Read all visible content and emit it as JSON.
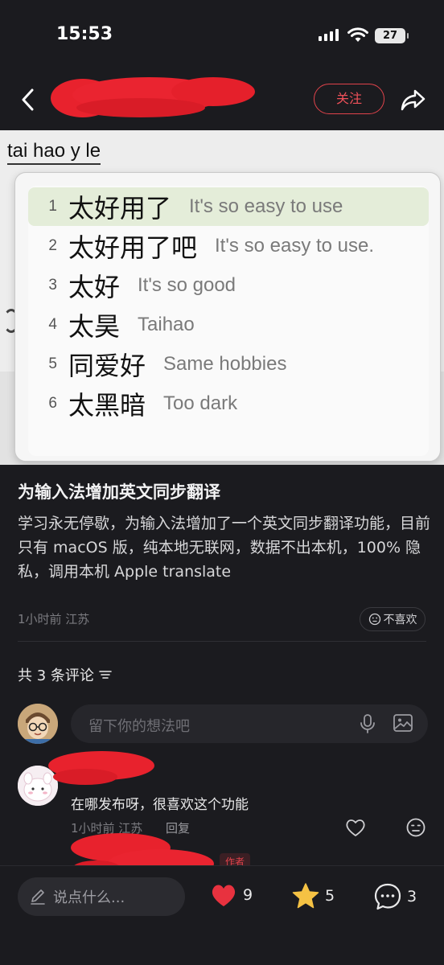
{
  "status_bar": {
    "time": "15:53",
    "battery": "27"
  },
  "header": {
    "follow_label": "关注"
  },
  "post_image": {
    "typed_text": "tai hao y le",
    "candidates": [
      {
        "num": "1",
        "zh": "太好用了",
        "en": "It's so easy to use"
      },
      {
        "num": "2",
        "zh": "太好用了吧",
        "en": "It's so easy to use."
      },
      {
        "num": "3",
        "zh": "太好",
        "en": "It's so good"
      },
      {
        "num": "4",
        "zh": "太昊",
        "en": "Taihao"
      },
      {
        "num": "5",
        "zh": "同爱好",
        "en": "Same hobbies"
      },
      {
        "num": "6",
        "zh": "太黑暗",
        "en": "Too dark"
      }
    ]
  },
  "post": {
    "title": "为输入法增加英文同步翻译",
    "body": "学习永无停歇，为输入法增加了一个英文同步翻译功能，目前只有 macOS 版，纯本地无联网，数据不出本机，100% 隐私，调用本机 Apple translate",
    "meta": "1小时前 江苏",
    "dislike_label": "不喜欢"
  },
  "comments": {
    "count_label": "共 3 条评论",
    "input_placeholder": "留下你的想法吧",
    "items": [
      {
        "text": "在哪发布呀，很喜欢这个功能",
        "meta": "1小时前 江苏",
        "reply_label": "回复"
      }
    ],
    "author_tag": "作者"
  },
  "bottom_bar": {
    "say_placeholder": "说点什么...",
    "likes": "9",
    "favorites": "5",
    "comments": "3"
  },
  "colors": {
    "accent_red": "#e0434b",
    "star": "#f5c244",
    "background": "#1b1b1f"
  }
}
